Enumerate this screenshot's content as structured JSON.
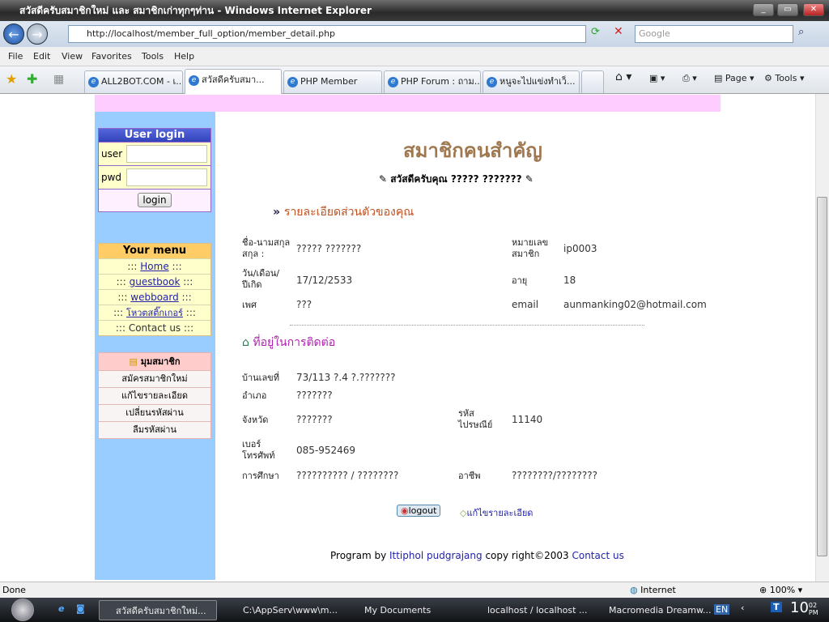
{
  "window": {
    "title": "สวัสดีครับสมาชิกใหม่ และ สมาชิกเก่าทุกๆท่าน - Windows Internet Explorer",
    "url": "http://localhost/member_full_option/member_detail.php",
    "search_placeholder": "Google"
  },
  "menu": [
    "File",
    "Edit",
    "View",
    "Favorites",
    "Tools",
    "Help"
  ],
  "tabs": [
    "ALL2BOT.COM - เ...",
    "สวัสดีครับสมา...",
    "PHP Member",
    "PHP Forum : ถาม...",
    "หนูจะไปแข่งทำเว็..."
  ],
  "toolbar": {
    "page": "Page",
    "tools": "Tools"
  },
  "login": {
    "title": "User login",
    "user_label": "user",
    "pwd_label": "pwd",
    "button": "login"
  },
  "your_menu": {
    "title": "Your menu",
    "items": [
      {
        "pre": "::: ",
        "label": "Home",
        "post": " :::"
      },
      {
        "pre": "::: ",
        "label": "guestbook",
        "post": " :::"
      },
      {
        "pre": "::: ",
        "label": "webboard",
        "post": " :::"
      },
      {
        "pre": "::: ",
        "label": "โหวตสติ๊กเกอร์",
        "post": " :::"
      }
    ],
    "contact": "::: Contact us :::"
  },
  "member_corner": {
    "title": "มุมสมาชิก",
    "items": [
      "สมัครสมาชิกใหม่",
      "แก้ไขรายละเอียด",
      "เปลี่ยนรหัสผ่าน",
      "ลืมรหัสผ่าน"
    ]
  },
  "main": {
    "heading": "สมาชิกคนสำคัญ",
    "greeting": "สวัสดีครับคุณ  ????? ???????",
    "section1": "รายละเอียดส่วนตัวของคุณ",
    "section2": "ที่อยู่ในการติดต่อ",
    "personal": {
      "name_label": "ชื่อ-นามสกุล สกุล :",
      "name": "????? ???????",
      "id_label": "หมายเลข สมาชิก",
      "id": "ip0003",
      "dob_label": "วัน/เดือน/ ปีเกิด",
      "dob": "17/12/2533",
      "age_label": "อายุ",
      "age": "18",
      "sex_label": "เพศ",
      "sex": "???",
      "email_label": "email",
      "email": "aunmanking02@hotmail.com"
    },
    "address": {
      "house_label": "บ้านเลขที่",
      "house": "73/113 ?.4 ?.???????",
      "district_label": "อำเภอ",
      "district": "???????",
      "province_label": "จังหวัด",
      "province": "???????",
      "zip_label": "รหัส ไปรษณีย์",
      "zip": "11140",
      "phone_label": "เบอร์ โทรศัพท์",
      "phone": "085-952469",
      "edu_label": "การศึกษา",
      "edu": "?????????? / ????????",
      "job_label": "อาชีพ",
      "job": "????????/????????"
    },
    "logout": "logout",
    "edit": "แก้ไขรายละเอียด",
    "footer": {
      "pre": "Program by ",
      "author": "Ittiphol pudgrajang",
      "mid": "  copy right©2003 ",
      "contact": "Contact us"
    }
  },
  "status": {
    "text": "Done",
    "zone": "Internet",
    "zoom": "100%"
  },
  "taskbar": {
    "items": [
      "สวัสดีครับสมาชิกใหม่...",
      "C:\\AppServ\\www\\m...",
      "My Documents",
      "localhost / localhost ...",
      "Macromedia Dreamw..."
    ],
    "lang": "EN",
    "time": "10",
    "time_min": "02",
    "ampm": "PM"
  }
}
